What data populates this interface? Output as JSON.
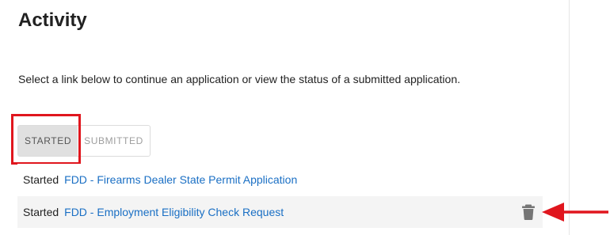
{
  "page": {
    "title": "Activity",
    "intro": "Select a link below to continue an application or view the status of a submitted application."
  },
  "tabs": [
    {
      "label": "STARTED",
      "active": true
    },
    {
      "label": "SUBMITTED",
      "active": false
    }
  ],
  "applications": [
    {
      "status": "Started",
      "name": "FDD - Firearms Dealer State Permit Application",
      "deletable": false
    },
    {
      "status": "Started",
      "name": "FDD - Employment Eligibility Check Request",
      "deletable": true
    }
  ],
  "icons": {
    "delete": "trash-icon"
  },
  "colors": {
    "link": "#1a6fc4",
    "annotation": "#e0161e",
    "active_tab_bg": "#e0e0e0",
    "row_alt_bg": "#f4f4f4"
  }
}
